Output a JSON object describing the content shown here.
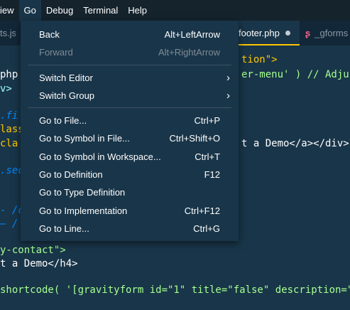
{
  "menubar": {
    "items": [
      "iew",
      "Go",
      "Debug",
      "Terminal",
      "Help"
    ]
  },
  "tabs": {
    "tab1": "ts.js",
    "tab2": "footer.php",
    "tab3": "_gforms"
  },
  "code_lines": {
    "l1": "tion\">",
    "l2": "php",
    "l2b": "er-menu' ) // Adjus",
    "l3": "v>",
    "l4": ".fi",
    "l5": "lass",
    "l6": "cla",
    "l6b": "t a Demo</a></div>",
    "l7": ".sec",
    "l8": "- /c",
    "l9": "— /",
    "l10": "y-contact\">",
    "l11": "t a Demo</h4>",
    "l12": "shortcode( '[gravityform id=\"1\" title=\"false\" description=\"",
    "l13": ""
  },
  "go_menu": {
    "back": {
      "label": "Back",
      "shortcut": "Alt+LeftArrow"
    },
    "forward": {
      "label": "Forward",
      "shortcut": "Alt+RightArrow"
    },
    "switch_editor": {
      "label": "Switch Editor"
    },
    "switch_group": {
      "label": "Switch Group"
    },
    "go_to_file": {
      "label": "Go to File...",
      "shortcut": "Ctrl+P"
    },
    "go_to_symbol_file": {
      "label": "Go to Symbol in File...",
      "shortcut": "Ctrl+Shift+O"
    },
    "go_to_symbol_workspace": {
      "label": "Go to Symbol in Workspace...",
      "shortcut": "Ctrl+T"
    },
    "go_to_definition": {
      "label": "Go to Definition",
      "shortcut": "F12"
    },
    "go_to_type_definition": {
      "label": "Go to Type Definition"
    },
    "go_to_implementation": {
      "label": "Go to Implementation",
      "shortcut": "Ctrl+F12"
    },
    "go_to_line": {
      "label": "Go to Line...",
      "shortcut": "Ctrl+G"
    }
  },
  "colors": {
    "background": "#193549",
    "menubar": "#15232d",
    "accent": "#ffc600"
  }
}
